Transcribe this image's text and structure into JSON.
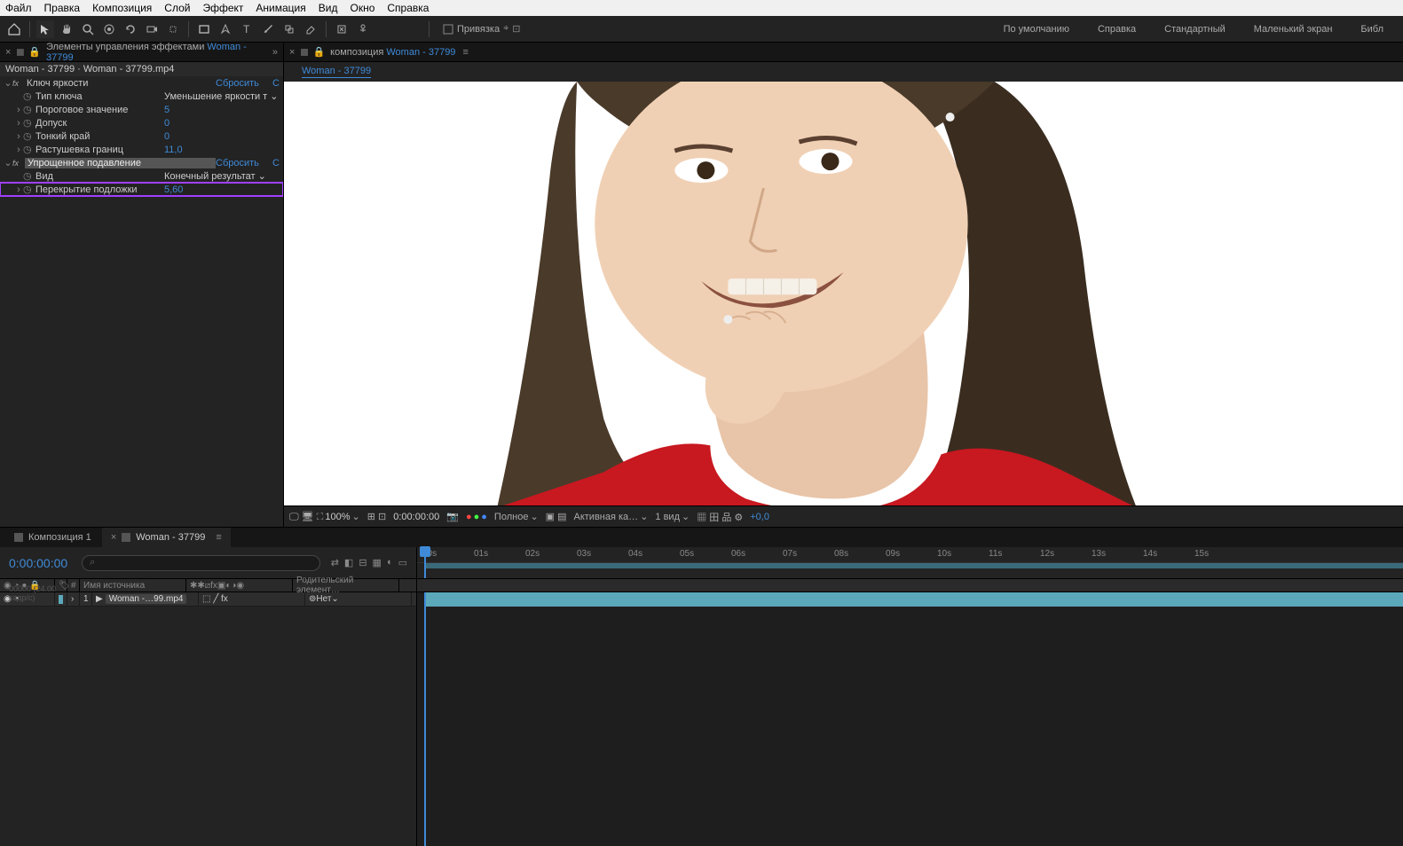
{
  "menubar": [
    "Файл",
    "Правка",
    "Композиция",
    "Слой",
    "Эффект",
    "Анимация",
    "Вид",
    "Окно",
    "Справка"
  ],
  "toolbar": {
    "snap_label": "Привязка"
  },
  "workspaces": [
    "По умолчанию",
    "Справка",
    "Стандартный",
    "Маленький экран",
    "Библ"
  ],
  "effects_panel": {
    "tab_prefix": "Элементы управления эффектами ",
    "tab_link": "Woman - 37799",
    "source_line": "Woman - 37799 · Woman - 37799.mp4",
    "effects": [
      {
        "name": "Ключ яркости",
        "reset": "Сбросить",
        "c": "С",
        "props": [
          {
            "name": "Тип ключа",
            "value": "Уменьшение яркости т",
            "type": "dropdown"
          },
          {
            "name": "Пороговое значение",
            "value": "5"
          },
          {
            "name": "Допуск",
            "value": "0"
          },
          {
            "name": "Тонкий край",
            "value": "0"
          },
          {
            "name": "Растушевка границ",
            "value": "11,0"
          }
        ]
      },
      {
        "name": "Упрощенное подавление",
        "reset": "Сбросить",
        "c": "С",
        "highlighted": true,
        "props": [
          {
            "name": "Вид",
            "value": "Конечный результат",
            "type": "dropdown"
          },
          {
            "name": "Перекрытие подложки",
            "value": "5,60",
            "boxed": true
          }
        ]
      }
    ]
  },
  "viewer": {
    "tab_prefix": "композиция ",
    "tab_link": "Woman - 37799",
    "title": "Woman - 37799",
    "controls": {
      "zoom": "100%",
      "timecode": "0:00:00:00",
      "resolution": "Полное",
      "camera": "Активная ка…",
      "view": "1 вид",
      "exposure": "+0,0"
    }
  },
  "timeline": {
    "tabs": [
      {
        "label": "Композиция 1",
        "active": false
      },
      {
        "label": "Woman - 37799",
        "active": true
      }
    ],
    "timecode": "0:00:00:00",
    "fps": "00000 (24.00 кадр/с)",
    "columns": {
      "source": "Имя источника",
      "parent": "Родительский элемент…"
    },
    "ruler": [
      "00s",
      "01s",
      "02s",
      "03s",
      "04s",
      "05s",
      "06s",
      "07s",
      "08s",
      "09s",
      "10s",
      "11s",
      "12s",
      "13s",
      "14s",
      "15s"
    ],
    "layers": [
      {
        "index": "1",
        "name": "Woman -…99.mp4",
        "parent": "Нет"
      }
    ]
  }
}
